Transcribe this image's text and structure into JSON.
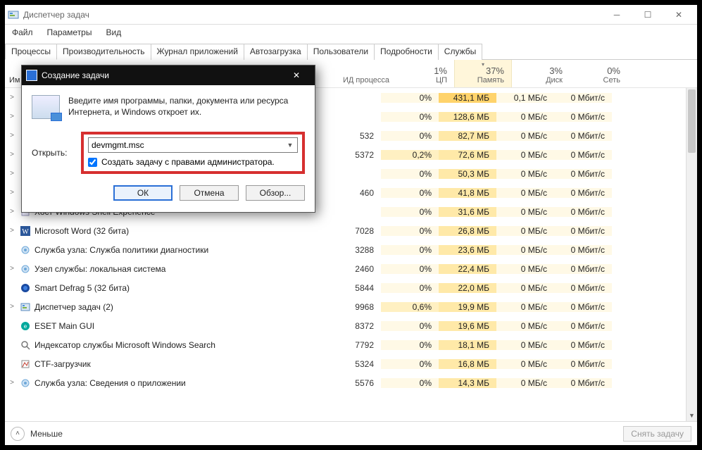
{
  "window": {
    "title": "Диспетчер задач",
    "menu": {
      "file": "Файл",
      "options": "Параметры",
      "view": "Вид"
    }
  },
  "tabs": [
    "Процессы",
    "Производительность",
    "Журнал приложений",
    "Автозагрузка",
    "Пользователи",
    "Подробности",
    "Службы"
  ],
  "active_tab_index": 0,
  "headers": {
    "name": "Им",
    "pid": "ИД процесса",
    "cpu_pct": "1%",
    "cpu_label": "ЦП",
    "mem_pct": "37%",
    "mem_label": "Память",
    "disk_pct": "3%",
    "disk_label": "Диск",
    "net_pct": "0%",
    "net_label": "Сеть"
  },
  "footer": {
    "less": "Меньше",
    "end_task": "Снять задачу"
  },
  "dialog": {
    "title": "Создание задачи",
    "desc": "Введите имя программы, папки, документа или ресурса Интернета, и Windows откроет их.",
    "open_label": "Открыть:",
    "value": "devmgmt.msc",
    "admin_checkbox": "Создать задачу с правами администратора.",
    "ok": "ОК",
    "cancel": "Отмена",
    "browse": "Обзор..."
  },
  "rows": [
    {
      "exp": ">",
      "name": "",
      "pid": "",
      "cpu": "0%",
      "mem": "431,1 МБ",
      "disk": "0,1 МБ/с",
      "net": "0 Мбит/с",
      "mem_high": true
    },
    {
      "exp": ">",
      "name": "",
      "pid": "",
      "cpu": "0%",
      "mem": "128,6 МБ",
      "disk": "0 МБ/с",
      "net": "0 Мбит/с",
      "mem_high": false
    },
    {
      "exp": ">",
      "name": "",
      "pid": "532",
      "cpu": "0%",
      "mem": "82,7 МБ",
      "disk": "0 МБ/с",
      "net": "0 Мбит/с",
      "mem_high": false
    },
    {
      "exp": ">",
      "name": "",
      "pid": "5372",
      "cpu": "0,2%",
      "mem": "72,6 МБ",
      "disk": "0 МБ/с",
      "net": "0 Мбит/с",
      "mem_high": false,
      "cpu_nz": true
    },
    {
      "exp": ">",
      "name": "",
      "pid": "",
      "cpu": "0%",
      "mem": "50,3 МБ",
      "disk": "0 МБ/с",
      "net": "0 Мбит/с",
      "mem_high": false
    },
    {
      "exp": ">",
      "name": "",
      "pid": "460",
      "cpu": "0%",
      "mem": "41,8 МБ",
      "disk": "0 МБ/с",
      "net": "0 Мбит/с",
      "mem_high": false
    },
    {
      "exp": ">",
      "name": "Хост Windows Shell Experience",
      "pid": "",
      "cpu": "0%",
      "mem": "31,6 МБ",
      "disk": "0 МБ/с",
      "net": "0 Мбит/с",
      "mem_high": false,
      "leaf": true
    },
    {
      "exp": ">",
      "name": "Microsoft Word (32 бита)",
      "pid": "7028",
      "cpu": "0%",
      "mem": "26,8 МБ",
      "disk": "0 МБ/с",
      "net": "0 Мбит/с",
      "mem_high": false,
      "word": true
    },
    {
      "exp": "",
      "name": "Служба узла: Служба политики диагностики",
      "pid": "3288",
      "cpu": "0%",
      "mem": "23,6 МБ",
      "disk": "0 МБ/с",
      "net": "0 Мбит/с",
      "mem_high": false,
      "gear": true
    },
    {
      "exp": ">",
      "name": "Узел службы: локальная система",
      "pid": "2460",
      "cpu": "0%",
      "mem": "22,4 МБ",
      "disk": "0 МБ/с",
      "net": "0 Мбит/с",
      "mem_high": false,
      "gear": true
    },
    {
      "exp": "",
      "name": "Smart Defrag 5 (32 бита)",
      "pid": "5844",
      "cpu": "0%",
      "mem": "22,0 МБ",
      "disk": "0 МБ/с",
      "net": "0 Мбит/с",
      "mem_high": false,
      "blue": true
    },
    {
      "exp": ">",
      "name": "Диспетчер задач (2)",
      "pid": "9968",
      "cpu": "0,6%",
      "mem": "19,9 МБ",
      "disk": "0 МБ/с",
      "net": "0 Мбит/с",
      "mem_high": false,
      "cpu_nz": true,
      "tm": true
    },
    {
      "exp": "",
      "name": "ESET Main GUI",
      "pid": "8372",
      "cpu": "0%",
      "mem": "19,6 МБ",
      "disk": "0 МБ/с",
      "net": "0 Мбит/с",
      "mem_high": false,
      "eset": true
    },
    {
      "exp": "",
      "name": "Индексатор службы Microsoft Windows Search",
      "pid": "7792",
      "cpu": "0%",
      "mem": "18,1 МБ",
      "disk": "0 МБ/с",
      "net": "0 Мбит/с",
      "mem_high": false,
      "search": true
    },
    {
      "exp": "",
      "name": "CTF-загрузчик",
      "pid": "5324",
      "cpu": "0%",
      "mem": "16,8 МБ",
      "disk": "0 МБ/с",
      "net": "0 Мбит/с",
      "mem_high": false,
      "ctf": true
    },
    {
      "exp": ">",
      "name": "Служба узла: Сведения о приложении",
      "pid": "5576",
      "cpu": "0%",
      "mem": "14,3 МБ",
      "disk": "0 МБ/с",
      "net": "0 Мбит/с",
      "mem_high": false,
      "gear": true
    }
  ]
}
